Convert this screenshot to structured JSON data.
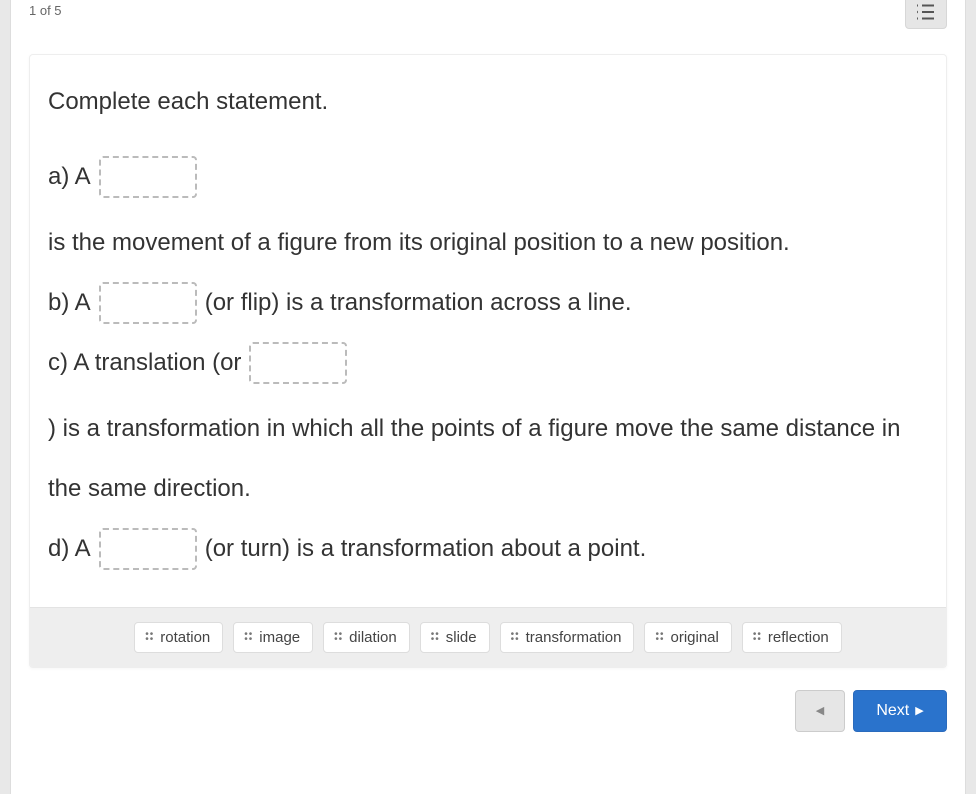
{
  "progress": "1 of 5",
  "question": {
    "title": "Complete each statement.",
    "parts": {
      "a_prefix": "a)  A",
      "a_suffix": "is the movement of a figure from its original position to a new position.",
      "b_prefix": "b) A",
      "b_suffix": "(or flip) is a transformation across a line.",
      "c_prefix": "c) A translation (or",
      "c_suffix": ") is a transformation in which all the points of a figure move the same distance in the same direction.",
      "d_prefix": "d) A",
      "d_suffix": "(or turn) is a transformation about a point."
    }
  },
  "answers": [
    "rotation",
    "image",
    "dilation",
    "slide",
    "transformation",
    "original",
    "reflection"
  ],
  "nav": {
    "next_label": "Next"
  }
}
